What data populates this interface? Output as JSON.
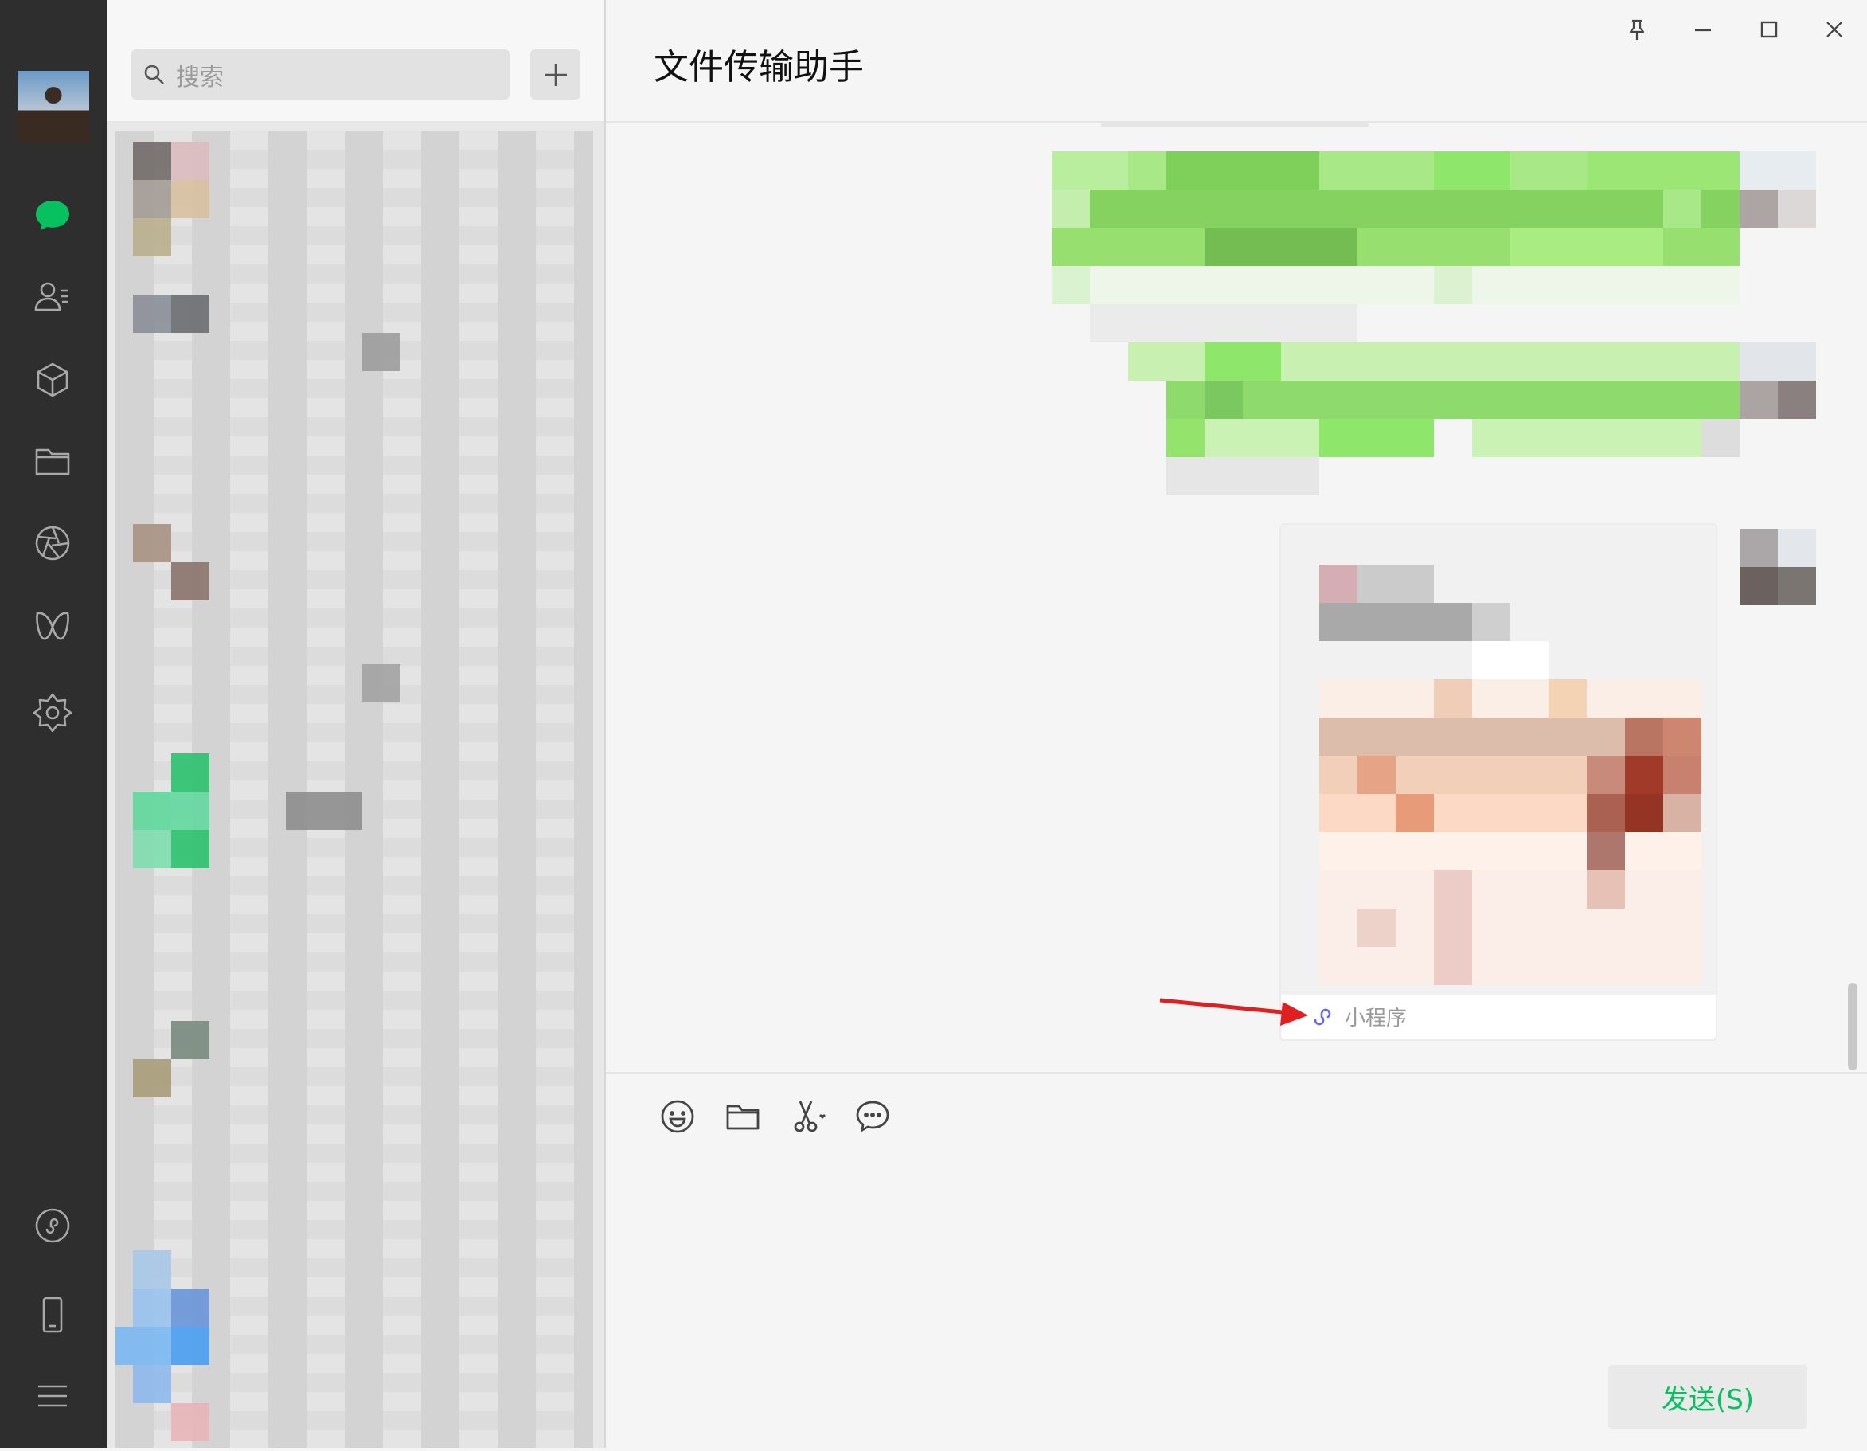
{
  "sidebar": {
    "icons": [
      "chat-icon",
      "contacts-icon",
      "favorites-icon",
      "files-icon",
      "moments-icon",
      "channels-icon",
      "search-discover-icon",
      "mini-program-icon",
      "phone-icon",
      "menu-icon"
    ],
    "accent": "#07c160"
  },
  "list": {
    "search_placeholder": "搜索",
    "add_symbol": "+"
  },
  "chat": {
    "title": "文件传输助手",
    "mini_program_label": "小程序"
  },
  "composer": {
    "tools": [
      "emoji-icon",
      "folder-icon",
      "scissors-icon",
      "chat-bubble-icon"
    ],
    "send_label": "发送(S)"
  },
  "colors": {
    "sidebar_bg": "#2e2e2e",
    "accent_green": "#07c160",
    "annotation_red": "#e02020",
    "mini_program_purple": "#6467f0"
  }
}
